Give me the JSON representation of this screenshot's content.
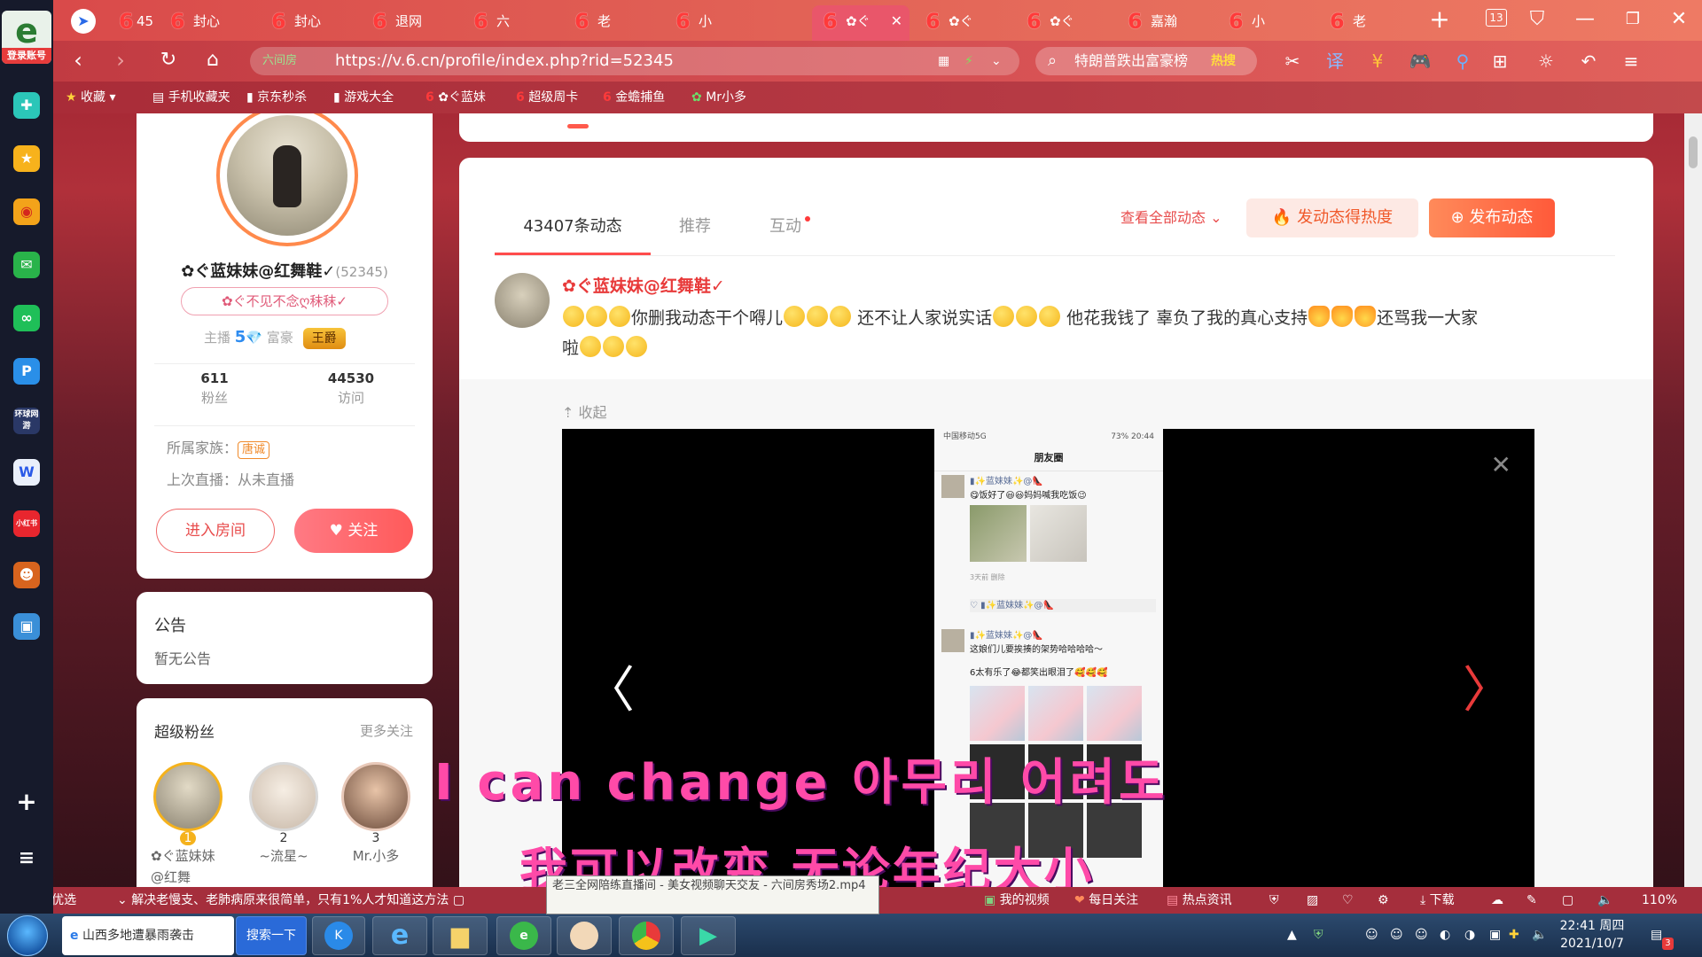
{
  "sidebar": {
    "login_label": "登录账号",
    "icons": [
      "plus-circle-icon",
      "favorites-star-icon",
      "weibo-icon",
      "mail-icon",
      "wechat-icon",
      "letter-p-icon",
      "game-icon",
      "document-icon",
      "xiaohongshu-icon",
      "game-character-icon",
      "photo-icon"
    ],
    "icon_labels": {
      "game": "环球网游",
      "xiaohongshu": "小红书"
    },
    "add_label": "+",
    "menu_label": "≡"
  },
  "tabs": [
    {
      "label": "45",
      "icon": "nav-arrow-icon"
    },
    {
      "label": "封心"
    },
    {
      "label": "封心"
    },
    {
      "label": "退网"
    },
    {
      "label": "六"
    },
    {
      "label": "老"
    },
    {
      "label": "小"
    },
    {
      "label": "✿ぐ",
      "active": true
    },
    {
      "label": "✿ぐ"
    },
    {
      "label": "✿ぐ"
    },
    {
      "label": "嘉瀚"
    },
    {
      "label": "小"
    },
    {
      "label": "老"
    }
  ],
  "tab_count": "13",
  "address": {
    "safe_label": "六间房",
    "url": "https://v.6.cn/profile/index.php?rid=52345",
    "search_query": "特朗普跌出富豪榜",
    "search_hot": "热搜"
  },
  "bookmarks": [
    {
      "label": "收藏"
    },
    {
      "label": "手机收藏夹"
    },
    {
      "label": "京东秒杀"
    },
    {
      "label": "游戏大全"
    },
    {
      "label": "✿ぐ蓝妹"
    },
    {
      "label": "超级周卡"
    },
    {
      "label": "金蟾捕鱼"
    },
    {
      "label": "Mr小多"
    }
  ],
  "profile": {
    "name": "✿ぐ蓝妹妹@红舞鞋✓",
    "rid": "(52345)",
    "signature": "✿ぐ不见不念ღ秣秣✓",
    "level_anchor_label": "主播",
    "level_anchor_value": "5",
    "level_rich_label": "富豪",
    "rich_title": "王爵",
    "fans_count": "611",
    "fans_label": "粉丝",
    "visits_count": "44530",
    "visits_label": "访问",
    "family_label": "所属家族：",
    "family_value": "唐诚",
    "last_live": "上次直播：从未直播",
    "enter_room": "进入房间",
    "follow": "关注"
  },
  "announcement": {
    "title": "公告",
    "body": "暂无公告"
  },
  "super_fans": {
    "title": "超级粉丝",
    "more": "更多关注",
    "fans": [
      {
        "rank": "1",
        "name": "✿ぐ蓝妹妹@红舞"
      },
      {
        "rank": "2",
        "name": "~流星~"
      },
      {
        "rank": "3",
        "name": "Mr.小多"
      }
    ]
  },
  "feed": {
    "tabs": [
      {
        "label": "43407条动态"
      },
      {
        "label": "推荐"
      },
      {
        "label": "互动"
      }
    ],
    "view_all": "查看全部动态",
    "heat_button": "发动态得热度",
    "post_button": "发布动态",
    "post": {
      "author": "✿ぐ蓝妹妹@红舞鞋✓",
      "text_1": "你删我动态干个嘚儿",
      "text_2": "还不让人家说实话",
      "text_3": "他花我钱了 辜负了我的真心支持",
      "text_4": "还骂我一大家",
      "text_5": "啦",
      "collapse": "收起"
    },
    "phone_screen": {
      "status_left": "中国移动5G",
      "status_right": "73% 20:44",
      "title": "朋友圈",
      "post1_name": "▮✨蓝妹妹✨@👠",
      "post1_text": "😋饭好了😃😃妈妈喊我吃饭😉",
      "post1_meta": "3天前  删除",
      "post1_like": "♡ ▮✨蓝妹妹✨@👠",
      "post2_name": "▮✨蓝妹妹✨@👠",
      "post2_text": "这娘们儿要挨揍的架势哈哈哈哈～",
      "post2_sub": "6太有乐了😂都笑出眼泪了🥰🥰🥰"
    },
    "subtitle_1": "I can change 아무리 어려도",
    "subtitle_2": "我可以改变 无论年纪大小"
  },
  "statusbar": {
    "today": "今日优选",
    "headline": "解决老慢支、老肺病原来很简单，只有1%人才知道这方法",
    "my_video": "我的视频",
    "daily": "每日关注",
    "hotnews": "热点资讯",
    "download": "下载",
    "zoom": "110%"
  },
  "tooltip": "老三全网陪练直播间 - 美女视频聊天交友 - 六间房秀场2.mp4",
  "taskbar": {
    "news_label": "山西多地遭暴雨袭击",
    "search_btn": "搜索一下",
    "time": "22:41 周四",
    "date": "2021/10/7",
    "notif_count": "3"
  },
  "colors": {
    "accent_red": "#e84c4c",
    "orange": "#f0592a",
    "pink_sub": "#ff4aa8"
  }
}
